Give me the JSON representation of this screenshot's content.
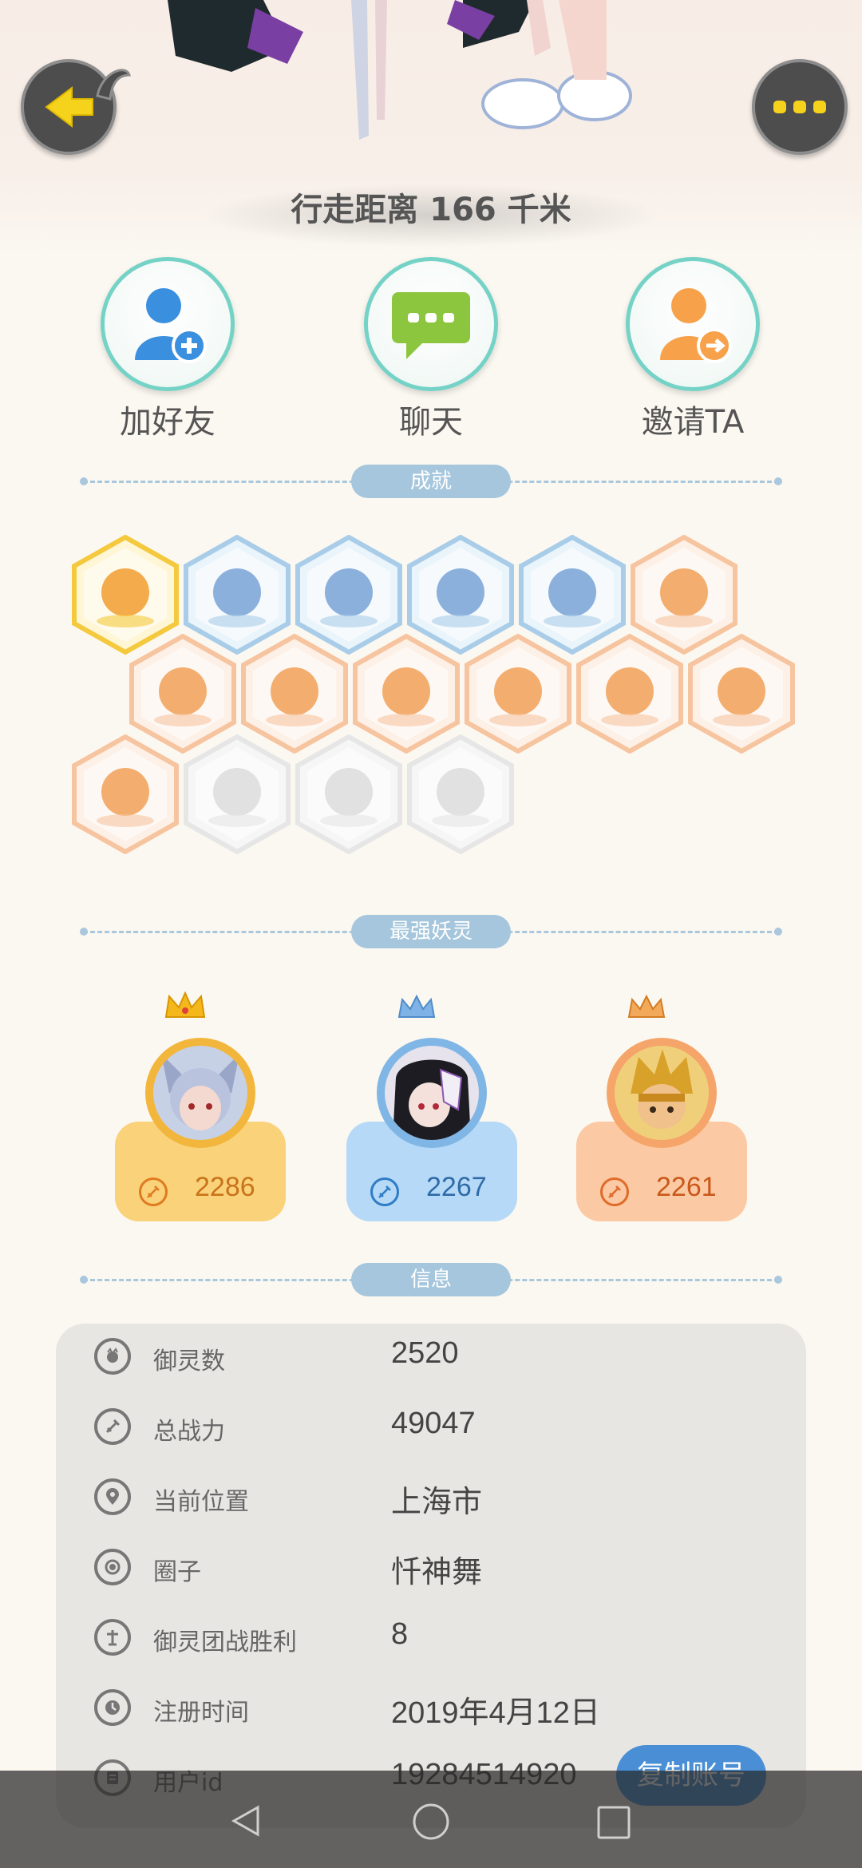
{
  "header": {
    "distance_text": "行走距离 166 千米"
  },
  "actions": [
    {
      "label": "加好友",
      "icon": "add-friend-icon"
    },
    {
      "label": "聊天",
      "icon": "chat-icon"
    },
    {
      "label": "邀请TA",
      "icon": "invite-icon"
    }
  ],
  "sections": {
    "achievements": "成就",
    "top_spirits": "最强妖灵",
    "info": "信息"
  },
  "achievement_badges": [
    {
      "icon": "angry-face-badge-icon",
      "tier": "gold"
    },
    {
      "icon": "sneaker-badge-icon",
      "tier": "blue"
    },
    {
      "icon": "lens-badge-icon",
      "tier": "blue"
    },
    {
      "icon": "cat-spirit-badge-icon",
      "tier": "blue"
    },
    {
      "icon": "yin-yang-badge-icon",
      "tier": "blue"
    },
    {
      "icon": "moon-badge-icon",
      "tier": "orange"
    },
    {
      "icon": "shell-badge-icon",
      "tier": "orange"
    },
    {
      "icon": "crystal-badge-icon",
      "tier": "orange"
    },
    {
      "icon": "taiji-badge-icon",
      "tier": "orange"
    },
    {
      "icon": "bear-badge-icon",
      "tier": "orange"
    },
    {
      "icon": "stroller-badge-icon",
      "tier": "orange"
    },
    {
      "icon": "scroll-badge-icon",
      "tier": "orange"
    },
    {
      "icon": "cats-badge-icon",
      "tier": "orange"
    },
    {
      "icon": "koi-badge-icon",
      "tier": "locked"
    },
    {
      "icon": "demon-badge-icon",
      "tier": "locked"
    },
    {
      "icon": "book-fox-badge-icon",
      "tier": "locked"
    }
  ],
  "top_spirits": [
    {
      "power": "2286",
      "tier": "gold",
      "avatar": "fox-girl-avatar"
    },
    {
      "power": "2267",
      "tier": "blue",
      "avatar": "masked-girl-avatar"
    },
    {
      "power": "2261",
      "tier": "orange",
      "avatar": "golden-warrior-avatar"
    }
  ],
  "info": [
    {
      "label": "御灵数",
      "value": "2520",
      "icon": "spirit-count-icon"
    },
    {
      "label": "总战力",
      "value": "49047",
      "icon": "power-icon"
    },
    {
      "label": "当前位置",
      "value": "上海市",
      "icon": "location-icon"
    },
    {
      "label": "圈子",
      "value": "忏神舞",
      "icon": "circle-icon"
    },
    {
      "label": "御灵团战胜利",
      "value": "8",
      "icon": "battle-icon"
    },
    {
      "label": "注册时间",
      "value": "2019年4月12日",
      "icon": "clock-icon"
    },
    {
      "label": "用户id",
      "value": "19284514920",
      "icon": "id-icon"
    }
  ],
  "copy_button": "复制账号",
  "colors": {
    "accent_teal": "#74d2c6",
    "section_pill": "#a5c6dc",
    "gold_card": "#f9d27a",
    "blue_card": "#b5d9f6",
    "orange_card": "#fbc9a3",
    "copy_button": "#4a8fd6"
  }
}
